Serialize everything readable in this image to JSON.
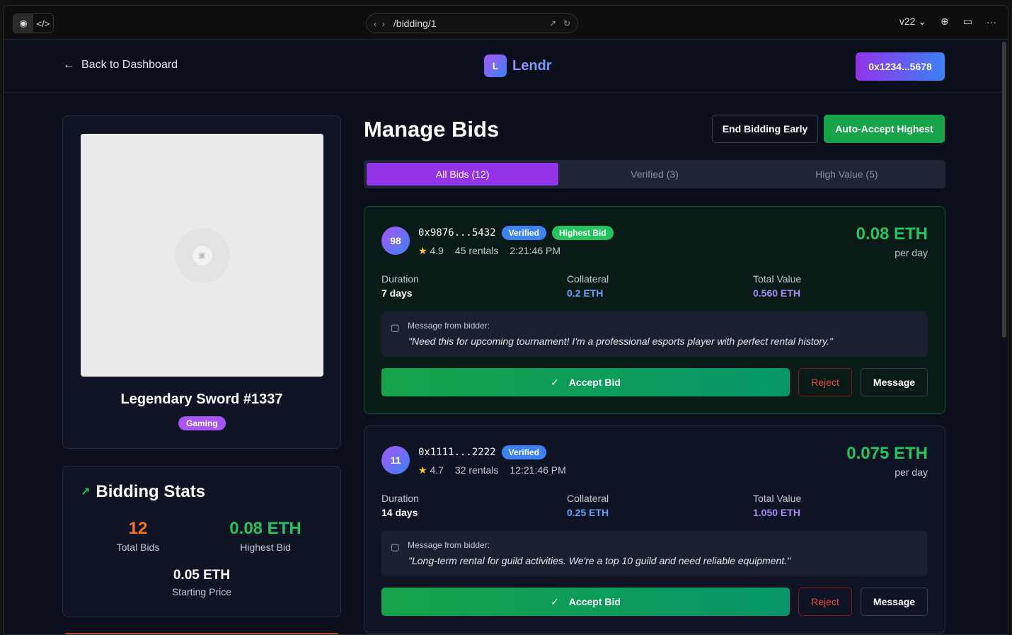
{
  "browser": {
    "url": "/bidding/1",
    "version": "v22"
  },
  "header": {
    "back_label": "Back to Dashboard",
    "logo_letter": "L",
    "brand": "Lendr",
    "wallet": "0x1234...5678"
  },
  "nft": {
    "title": "Legendary Sword #1337",
    "tag": "Gaming"
  },
  "stats": {
    "title": "Bidding Stats",
    "total_bids_value": "12",
    "total_bids_label": "Total Bids",
    "highest_bid_value": "0.08 ETH",
    "highest_bid_label": "Highest Bid",
    "starting_price_value": "0.05 ETH",
    "starting_price_label": "Starting Price"
  },
  "manage": {
    "title": "Manage Bids",
    "end_button": "End Bidding Early",
    "auto_button": "Auto-Accept Highest",
    "tabs": [
      "All Bids (12)",
      "Verified (3)",
      "High Value (5)"
    ]
  },
  "labels": {
    "duration": "Duration",
    "collateral": "Collateral",
    "total_value": "Total Value",
    "per_day": "per day",
    "message_header": "Message from bidder:",
    "accept": "Accept Bid",
    "reject": "Reject",
    "message": "Message",
    "verified": "Verified",
    "highest": "Highest Bid"
  },
  "bids": [
    {
      "score": "98",
      "address": "0x9876...5432",
      "rating": "4.9",
      "rentals": "45 rentals",
      "time": "2:21:46 PM",
      "price": "0.08 ETH",
      "duration": "7 days",
      "collateral": "0.2 ETH",
      "total": "0.560 ETH",
      "message": "\"Need this for upcoming tournament! I'm a professional esports player with perfect rental history.\""
    },
    {
      "score": "11",
      "address": "0x1111...2222",
      "rating": "4.7",
      "rentals": "32 rentals",
      "time": "12:21:46 PM",
      "price": "0.075 ETH",
      "duration": "14 days",
      "collateral": "0.25 ETH",
      "total": "1.050 ETH",
      "message": "\"Long-term rental for guild activities. We're a top 10 guild and need reliable equipment.\""
    }
  ],
  "colors": {
    "accent_purple": "#9333ea",
    "accent_green": "#22c55e",
    "accent_blue": "#3b82f6",
    "danger": "#ef4444"
  }
}
